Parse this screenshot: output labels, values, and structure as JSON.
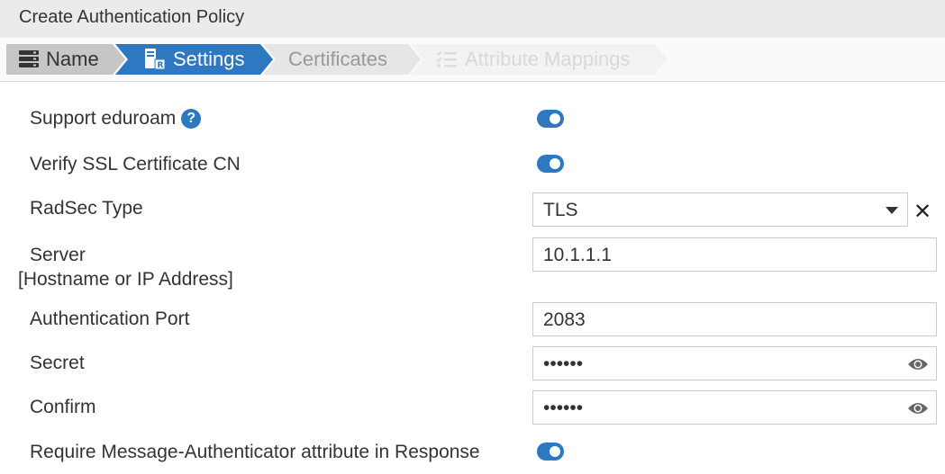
{
  "title": "Create Authentication Policy",
  "steps": [
    {
      "label": "Name",
      "icon": "server-icon"
    },
    {
      "label": "Settings",
      "icon": "radius-server-icon"
    },
    {
      "label": "Certificates"
    },
    {
      "label": "Attribute Mappings",
      "icon": "checklist-icon"
    }
  ],
  "form": {
    "support_eduroam": {
      "label": "Support eduroam",
      "value": true
    },
    "verify_ssl": {
      "label": "Verify SSL Certificate CN",
      "value": true
    },
    "radsec_type": {
      "label": "RadSec Type",
      "value": "TLS"
    },
    "server": {
      "label": "Server",
      "sublabel": "[Hostname or IP Address]",
      "value": "10.1.1.1"
    },
    "auth_port": {
      "label": "Authentication Port",
      "value": "2083"
    },
    "secret": {
      "label": "Secret",
      "value": "••••••"
    },
    "confirm": {
      "label": "Confirm",
      "value": "••••••"
    },
    "require_msg_auth": {
      "label": "Require Message-Authenticator attribute in Response",
      "value": true
    }
  },
  "colors": {
    "accent": "#2d78c0"
  }
}
